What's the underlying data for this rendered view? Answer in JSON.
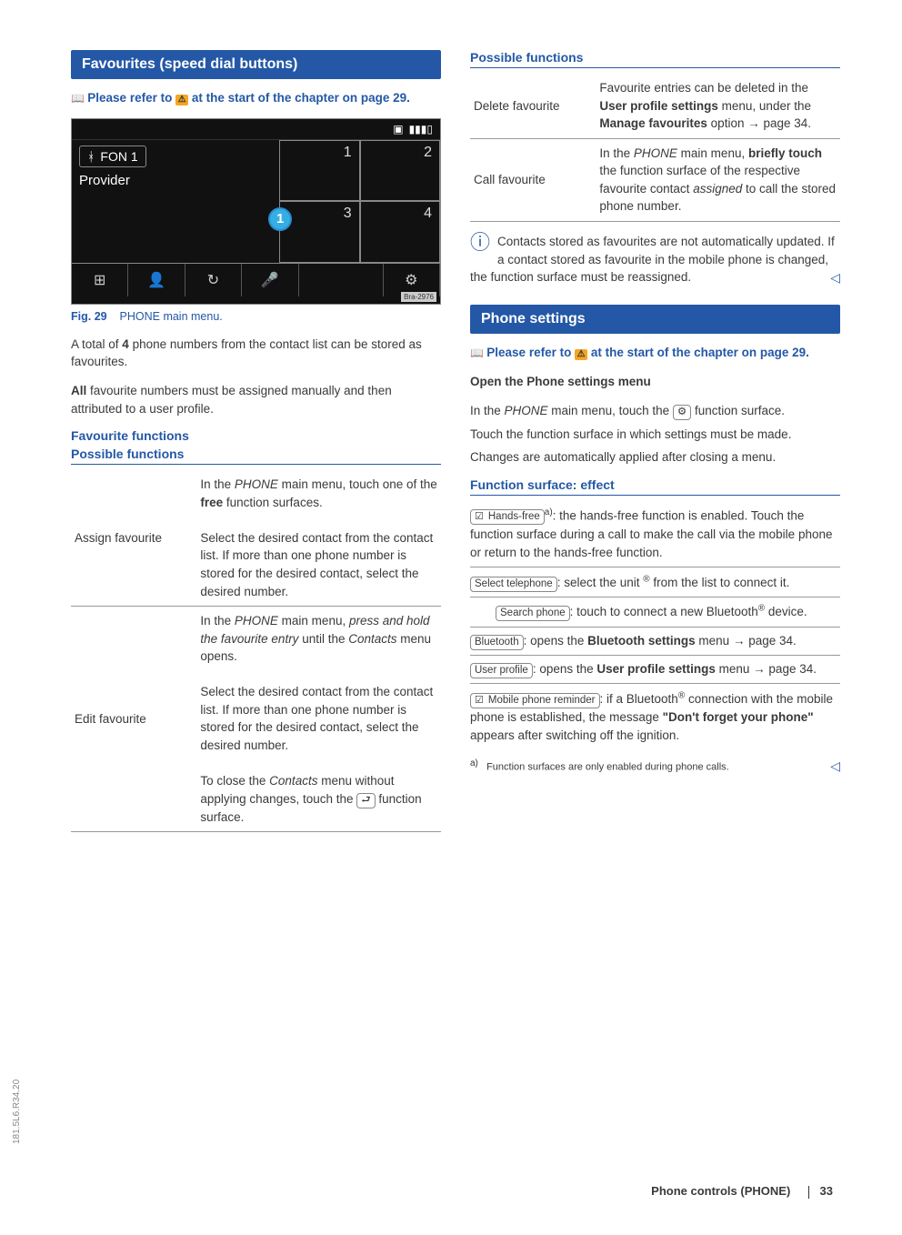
{
  "left": {
    "section_title": "Favourites (speed dial buttons)",
    "refer_prefix": "Please refer to ",
    "refer_suffix": " at the start of the chapter on page 29.",
    "figure": {
      "fon_label": "FON 1",
      "provider": "Provider",
      "sd": [
        "1",
        "2",
        "3",
        "4"
      ],
      "callout": "1",
      "bra": "Bra-2976",
      "caption_num": "Fig. 29",
      "caption_text": "PHONE main menu."
    },
    "para1": "A total of 4 phone numbers from the contact list can be stored as favourites.",
    "para2": "All favourite numbers must be assigned manually and then attributed to a user profile.",
    "fav_functions": "Favourite functions",
    "table_head": "Possible functions",
    "rows": [
      {
        "label": "Assign favourite",
        "text": "In the PHONE main menu, touch one of the free function surfaces.\nSelect the desired contact from the contact list. If more than one phone number is stored for the desired contact, select the desired number."
      },
      {
        "label": "Edit favourite",
        "text": "In the PHONE main menu, press and hold the favourite entry until the Contacts menu opens.\nSelect the desired contact from the contact list. If more than one phone number is stored for the desired contact, select the desired number.\nTo close the Contacts menu without applying changes, touch the ⮐ function surface."
      }
    ]
  },
  "right": {
    "table_head": "Possible functions",
    "rows": [
      {
        "label": "Delete favourite",
        "text": "Favourite entries can be deleted in the User profile settings menu, under the Manage favourites option → page 34."
      },
      {
        "label": "Call favourite",
        "text": "In the PHONE main menu, briefly touch the function surface of the respective favourite contact assigned to call the stored phone number."
      }
    ],
    "info_text": "Contacts stored as favourites are not automatically updated. If a contact stored as favourite in the mobile phone is changed, the function surface must be reassigned.",
    "section_title": "Phone settings",
    "refer_prefix": "Please refer to ",
    "refer_suffix": " at the start of the chapter on page 29.",
    "open_head": "Open the Phone settings menu",
    "open_1": "In the PHONE main menu, touch the ⚙ function surface.",
    "open_2": "Touch the function surface in which settings must be made.",
    "open_3": "Changes are automatically applied after closing a menu.",
    "surface_head": "Function surface: effect",
    "surf_handsfree_label": "Hands-free",
    "surf_handsfree": ": the hands-free function is enabled. Touch the function surface during a call to make the call via the mobile phone or return to the hands-free function.",
    "surf_select_label": "Select telephone",
    "surf_select": ": select the unit ® from the list to connect it.",
    "surf_search_label": "Search phone",
    "surf_search": ": touch to connect a new Bluetooth® device.",
    "surf_bt_label": "Bluetooth",
    "surf_bt": ": opens the Bluetooth settings menu → page 34.",
    "surf_user_label": "User profile",
    "surf_user": ": opens the User profile settings menu → page 34.",
    "surf_reminder_label": "Mobile phone reminder",
    "surf_reminder": ": if a Bluetooth® connection with the mobile phone is established, the message \"Don't forget your phone\" appears after switching off the ignition.",
    "footnote_mark": "a)",
    "footnote": "Function surfaces are only enabled during phone calls."
  },
  "side_label": "181.5L6.R34.20",
  "footer_title": "Phone controls (PHONE)",
  "footer_page": "33"
}
